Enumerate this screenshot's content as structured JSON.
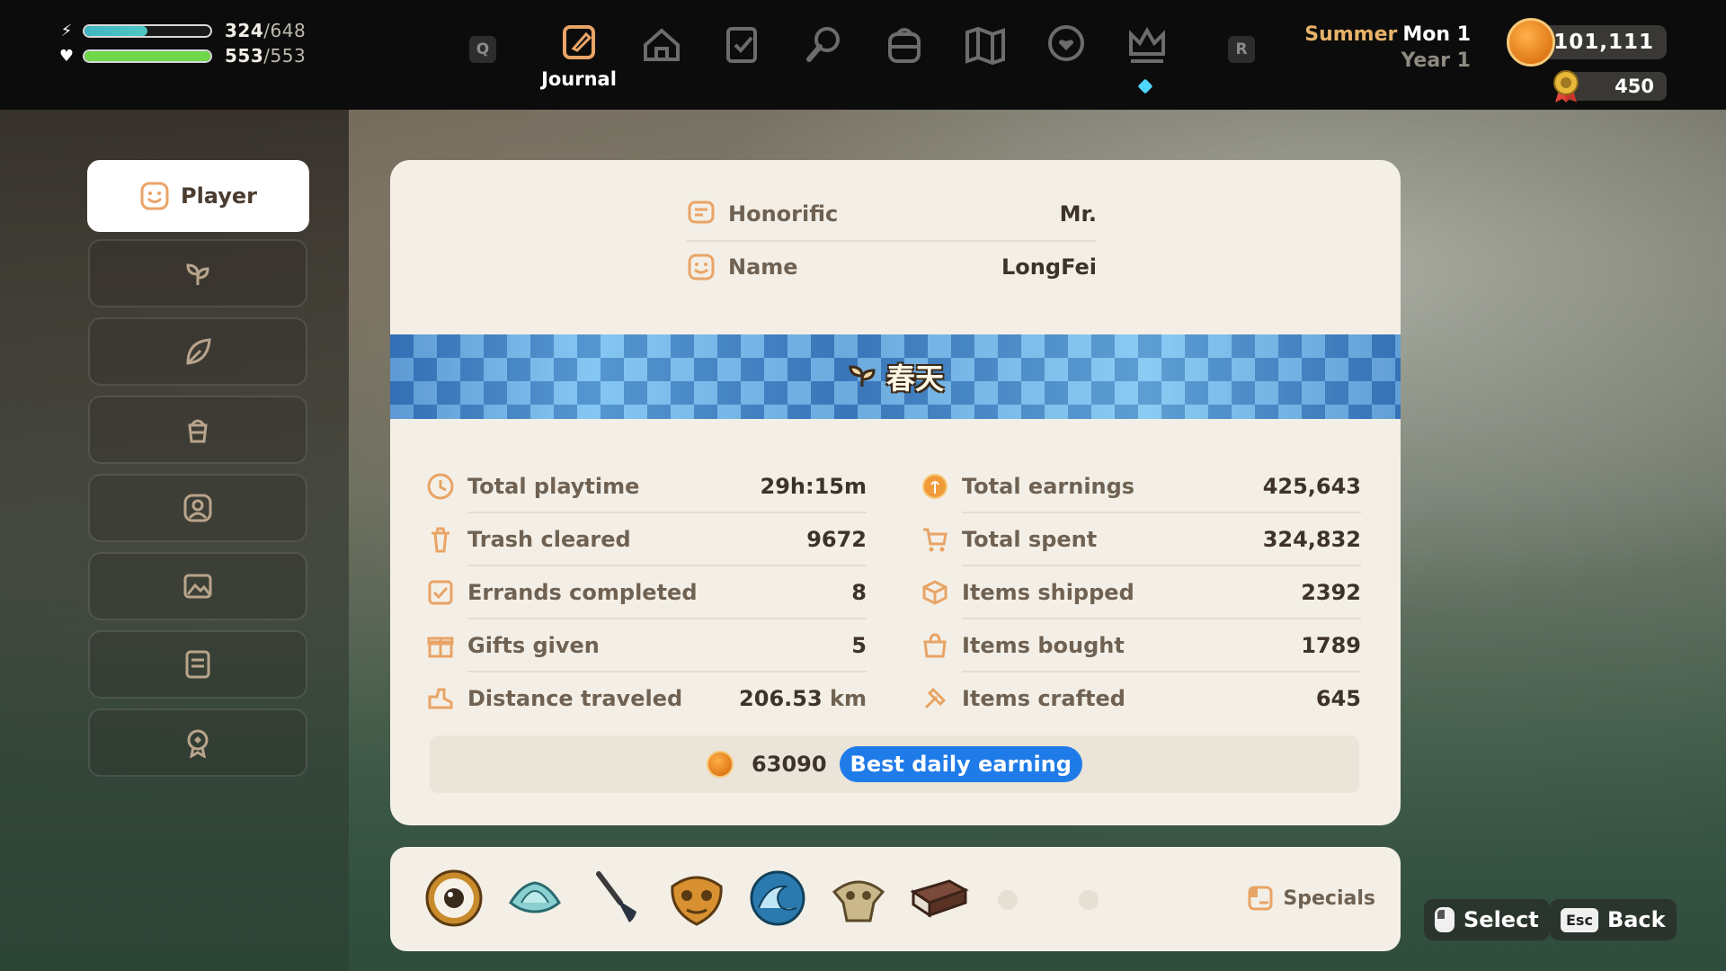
{
  "hud": {
    "energy": {
      "current": "324",
      "max": "/648",
      "fill_fraction": 0.5,
      "color": "#4ec7c4"
    },
    "health": {
      "current": "553",
      "max": "/553",
      "fill_fraction": 1.0,
      "color": "#6fd84a"
    }
  },
  "nav": {
    "left_key": "Q",
    "right_key": "R",
    "active_label": "Journal",
    "icons": [
      "journal-icon",
      "house-icon",
      "clipboard-icon",
      "wrench-icon",
      "backpack-icon",
      "map-icon",
      "heart-bubble-icon",
      "crown-icon"
    ]
  },
  "date": {
    "season": "Summer",
    "day": "Mon 1",
    "year": "Year 1"
  },
  "currency": {
    "gols": "101,111",
    "tokens": "450"
  },
  "sidebar": {
    "items": [
      {
        "label": "Player",
        "icon": "smiley-icon",
        "active": true
      },
      {
        "label": "",
        "icon": "sprout-icon"
      },
      {
        "label": "",
        "icon": "leaf-icon"
      },
      {
        "label": "",
        "icon": "pot-icon"
      },
      {
        "label": "",
        "icon": "portrait-icon"
      },
      {
        "label": "",
        "icon": "picture-icon"
      },
      {
        "label": "",
        "icon": "list-icon"
      },
      {
        "label": "",
        "icon": "badge-icon"
      }
    ]
  },
  "profile": {
    "honorific_label": "Honorific",
    "honorific_value": "Mr.",
    "name_label": "Name",
    "name_value": "LongFei",
    "banner_text": "春天"
  },
  "stats_left": [
    {
      "label": "Total playtime",
      "value": "29h:15m",
      "unit": "",
      "icon": "clock-icon"
    },
    {
      "label": "Trash cleared",
      "value": "9672",
      "unit": "",
      "icon": "trash-icon"
    },
    {
      "label": "Errands completed",
      "value": "8",
      "unit": "",
      "icon": "errand-icon"
    },
    {
      "label": "Gifts given",
      "value": "5",
      "unit": "",
      "icon": "gift-icon"
    },
    {
      "label": "Distance traveled",
      "value": "206.53",
      "unit": "km",
      "icon": "shoe-icon"
    }
  ],
  "stats_right": [
    {
      "label": "Total earnings",
      "value": "425,643",
      "icon": "coin-icon"
    },
    {
      "label": "Total spent",
      "value": "324,832",
      "icon": "cart-icon"
    },
    {
      "label": "Items shipped",
      "value": "2392",
      "icon": "box-icon"
    },
    {
      "label": "Items bought",
      "value": "1789",
      "icon": "bag-icon"
    },
    {
      "label": "Items crafted",
      "value": "645",
      "icon": "hammer-icon"
    }
  ],
  "best_daily": {
    "amount": "63090",
    "label": "Best daily earning"
  },
  "specials": {
    "label": "Specials",
    "items": [
      "eye-orb-icon",
      "lotus-icon",
      "brush-icon",
      "golden-mask-icon",
      "wave-icon",
      "bone-mask-icon",
      "book-icon"
    ],
    "empty_slots": 2
  },
  "hints": {
    "select_label": "Select",
    "back_key": "Esc",
    "back_label": "Back"
  },
  "colors": {
    "accent_blue": "#1f7be8",
    "card_bg": "#f4efe6",
    "text_brown": "#6f6253",
    "icon_orange": "#e8a467"
  }
}
